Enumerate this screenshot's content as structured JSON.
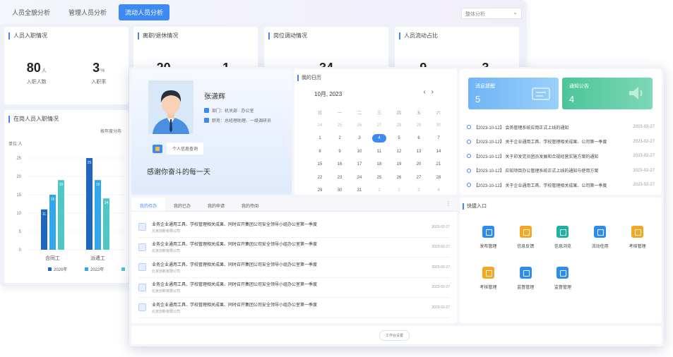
{
  "back_window": {
    "tabs": [
      "人员全貌分析",
      "管理人员分析",
      "流动人员分析"
    ],
    "active_tab": 2,
    "select_value": "整体分析",
    "kpis": [
      {
        "title": "人员入职情况",
        "values": [
          {
            "num": "80",
            "unit": "人",
            "label": "入职人数"
          },
          {
            "num": "3",
            "unit": "%",
            "label": "入职率"
          }
        ]
      },
      {
        "title": "离职/退休情况",
        "values": [
          {
            "num": "20",
            "unit": "人",
            "label": ""
          },
          {
            "num": "1",
            "unit": "%",
            "label": ""
          }
        ]
      },
      {
        "title": "岗位调动情况",
        "values": [
          {
            "num": "34",
            "unit": "人",
            "label": ""
          }
        ]
      },
      {
        "title": "人员流动占比",
        "values": [
          {
            "num": "9",
            "unit": "%",
            "label": ""
          },
          {
            "num": "3",
            "unit": "%",
            "label": ""
          }
        ]
      }
    ],
    "chart_card": {
      "title": "在岗人员入职情况",
      "subtitle": "按年度分布"
    }
  },
  "chart_data": {
    "type": "bar",
    "title": "在岗人员入职情况",
    "subtitle": "按年度分布",
    "ylabel": "单位:人",
    "ylim": [
      0,
      25
    ],
    "yticks": [
      0,
      5,
      10,
      15,
      20,
      25
    ],
    "categories": [
      "合同工",
      "派遣工"
    ],
    "series": [
      {
        "name": "2020年",
        "color": "#1f66c1",
        "values": [
          11,
          25
        ]
      },
      {
        "name": "2022年",
        "color": "#31a6ea",
        "values": [
          15,
          19
        ]
      },
      {
        "name": "",
        "color": "#4fc6c8",
        "values": [
          19,
          14
        ]
      }
    ],
    "legend_position": "bottom"
  },
  "profile": {
    "name": "张潇辉",
    "dept": "部门：机关部 · 办公室",
    "role": "职务：总经理助理、一级调研员",
    "link_label": "个人信息查询",
    "motto": "感谢你奋斗的每一天"
  },
  "calendar": {
    "title": "我的日历",
    "month_label": "10月, 2023",
    "prev": "‹",
    "next": "›",
    "dow": [
      "日",
      "一",
      "二",
      "三",
      "四",
      "五",
      "六"
    ],
    "weeks": [
      [
        "24",
        "25",
        "26",
        "27",
        "28",
        "29",
        "30"
      ],
      [
        "1",
        "2",
        "3",
        "4",
        "5",
        "6",
        "7"
      ],
      [
        "8",
        "9",
        "10",
        "11",
        "12",
        "13",
        "14"
      ],
      [
        "15",
        "16",
        "17",
        "18",
        "19",
        "20",
        "21"
      ],
      [
        "22",
        "23",
        "24",
        "25",
        "26",
        "27",
        "28"
      ],
      [
        "29",
        "30",
        "31",
        "1",
        "2",
        "3",
        "4"
      ]
    ],
    "today": "4"
  },
  "notices": {
    "cards": [
      {
        "title": "消息提醒",
        "value": "5",
        "color": "#6fb4f5"
      },
      {
        "title": "通知公告",
        "value": "4",
        "color": "#4cc59a"
      }
    ],
    "items": [
      {
        "text": "【2023-10-12】 会务管理系统应用正式上线的通知",
        "date": "2023-02-27"
      },
      {
        "text": "【2023-10-12】 关于企业通用工具、学校管理相关成果、公司第一季度",
        "date": "2023-02-27"
      },
      {
        "text": "【2023-10-12】 关于印发党员团员发展和合规经营实施方案的通知",
        "date": "2023-02-27"
      },
      {
        "text": "【2023-10-12】 应知项目办公管理系统正式上线的通知与使用方案",
        "date": "2023-02-27"
      },
      {
        "text": "【2023-10-12】 关于企业通用工具、学校管理相关成果、公司第一季度",
        "date": "2023-02-27"
      }
    ]
  },
  "todo": {
    "tabs": [
      "我的待办",
      "我的已办",
      "我的申请",
      "我的传阅"
    ],
    "more": "⋮",
    "items": [
      {
        "title": "业务企业通用工具、学校管理相关成果、同时召开集团公司安全领导小组办公室第一季度",
        "sub": "北京创新有限公司",
        "date": "2023-02-27"
      },
      {
        "title": "业务企业通用工具、学校管理相关成果、同时召开集团公司安全领导小组办公室第一季度",
        "sub": "北京创新有限公司",
        "date": "2023-02-27"
      },
      {
        "title": "业务企业通用工具、学校管理相关成果、同时召开集团公司安全领导小组办公室第一季度",
        "sub": "北京创新有限公司",
        "date": "2023-02-27"
      },
      {
        "title": "业务企业通用工具、学校管理相关成果、同时召开集团公司安全领导小组办公室第一季度",
        "sub": "北京创新有限公司",
        "date": "2023-02-27"
      },
      {
        "title": "业务企业通用工具、学校管理相关成果、同时召开集团公司安全领导小组办公室第一季度",
        "sub": "北京创新有限公司",
        "date": "2023-02-27"
      }
    ]
  },
  "quick": {
    "title": "快捷入口",
    "items": [
      {
        "label": "发布管理",
        "color": "#2d8cf0"
      },
      {
        "label": "信息反馈",
        "color": "#f5a623"
      },
      {
        "label": "信息浏览",
        "color": "#19b39f"
      },
      {
        "label": "流动任用",
        "color": "#2d8cf0"
      },
      {
        "label": "考核管理",
        "color": "#f5a623"
      },
      {
        "label": "考核管理",
        "color": "#f5a623"
      },
      {
        "label": "监督管理",
        "color": "#2d8cf0"
      },
      {
        "label": "监督管理",
        "color": "#2d8cf0"
      }
    ]
  },
  "footer": {
    "button": "工作台设置"
  }
}
